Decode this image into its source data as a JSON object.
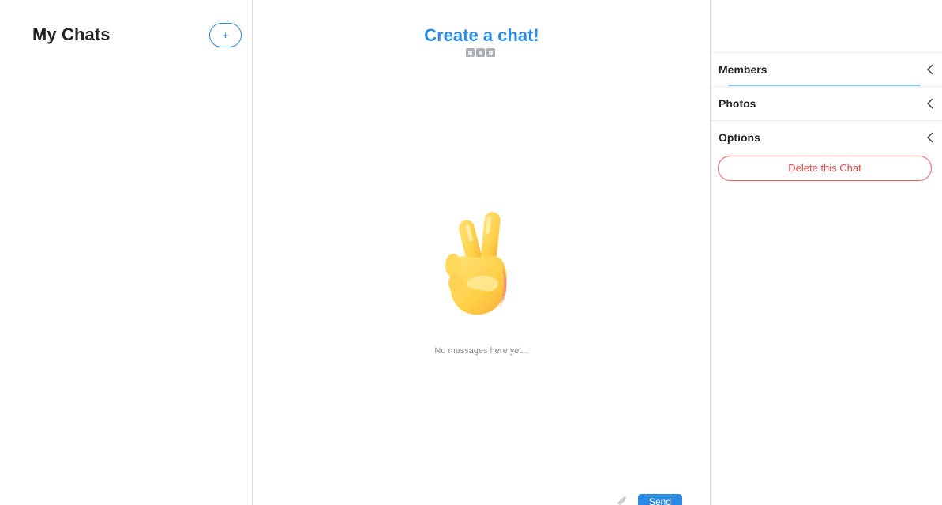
{
  "sidebar": {
    "title": "My Chats",
    "new_chat_label": "+"
  },
  "chat": {
    "title": "Create a chat!",
    "empty_message": "No messages here yet...",
    "send_label": "Send",
    "emoji": "victory-hand-emoji"
  },
  "details": {
    "sections": [
      {
        "label": "Members"
      },
      {
        "label": "Photos"
      },
      {
        "label": "Options"
      }
    ],
    "delete_label": "Delete this Chat"
  },
  "colors": {
    "accent": "#2a8be6",
    "danger": "#e44b4b",
    "muted_text": "#8c8c8c"
  }
}
